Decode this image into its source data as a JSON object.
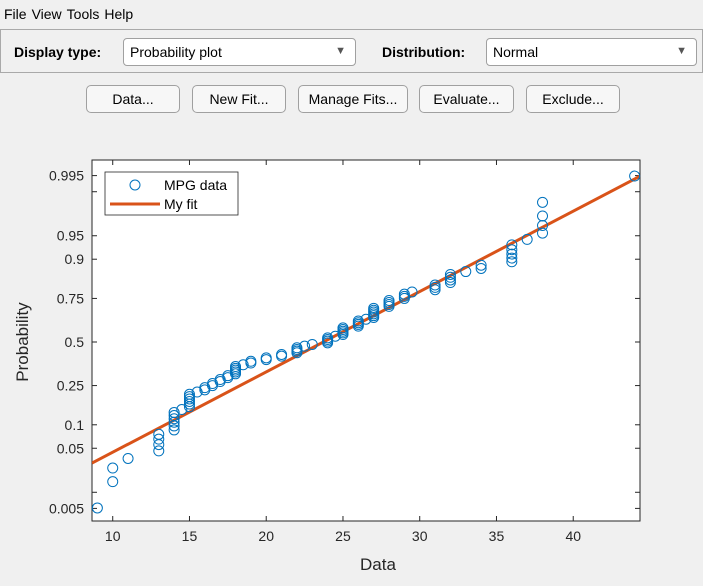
{
  "menu": [
    "File",
    "View",
    "Tools",
    "Help"
  ],
  "controls": {
    "display_type_label": "Display type:",
    "display_type_value": "Probability plot",
    "distribution_label": "Distribution:",
    "distribution_value": "Normal"
  },
  "buttons": [
    "Data...",
    "New Fit...",
    "Manage Fits...",
    "Evaluate...",
    "Exclude..."
  ],
  "chart_data": {
    "type": "scatter",
    "subtype": "normal probability plot",
    "xlabel": "Data",
    "ylabel": "Probability",
    "xlim": [
      8.65,
      44.35
    ],
    "xticks": [
      10,
      15,
      20,
      25,
      30,
      35,
      40
    ],
    "yticks": [
      0.005,
      0.01,
      0.05,
      0.1,
      0.25,
      0.5,
      0.75,
      0.9,
      0.95,
      0.99,
      0.995
    ],
    "ytick_labels": [
      "0.005",
      "",
      "0.05",
      "0.1",
      "0.25",
      "0.5",
      "0.75",
      "0.9",
      "0.95",
      "",
      "0.995"
    ],
    "y_scale": "normal-probability",
    "grid": false,
    "legend_placement": "top-left",
    "series": [
      {
        "name": "MPG data",
        "kind": "markers",
        "marker": "circle",
        "color": "#0072bd",
        "values": [
          9,
          10,
          10,
          11,
          13,
          13,
          13,
          13,
          14,
          14,
          14,
          14,
          14,
          14,
          14.5,
          15,
          15,
          15,
          15,
          15,
          15,
          15.5,
          16,
          16,
          16.5,
          16.5,
          17,
          17,
          17.5,
          17.5,
          18,
          18,
          18,
          18,
          18,
          18.5,
          19,
          19,
          20,
          20,
          21,
          21,
          22,
          22,
          22,
          22,
          22.5,
          23,
          24,
          24,
          24,
          24,
          24.5,
          25,
          25,
          25,
          25,
          25,
          26,
          26,
          26,
          26,
          26.5,
          27,
          27,
          27,
          27,
          27,
          27,
          28,
          28,
          28,
          28,
          29,
          29,
          29,
          29.5,
          31,
          31,
          31,
          32,
          32,
          32,
          32,
          33,
          34,
          34,
          36,
          36,
          36,
          36,
          36,
          37,
          38,
          38,
          38,
          38,
          44
        ]
      },
      {
        "name": "My fit",
        "kind": "line",
        "distribution": "Normal",
        "mu": 23.72,
        "sigma": 8.04,
        "color": "#d95319"
      }
    ]
  }
}
